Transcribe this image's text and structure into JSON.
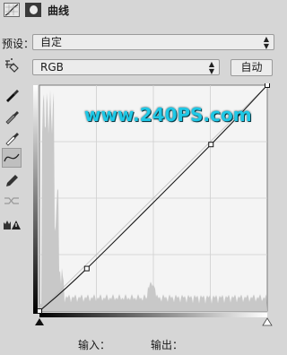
{
  "header": {
    "title": "曲线",
    "icons": [
      "curves-adjustment-icon",
      "layer-mask-icon"
    ]
  },
  "preset": {
    "label": "预设：",
    "value": "自定"
  },
  "channel": {
    "value": "RGB",
    "auto_button": "自动"
  },
  "tools": [
    "on-image-adjust-icon",
    "black-point-eyedropper-icon",
    "gray-point-eyedropper-icon",
    "white-point-eyedropper-icon",
    "curve-edit-icon",
    "pencil-draw-icon",
    "smooth-curve-icon",
    "clipping-warning-icon"
  ],
  "watermark": "www.240PS.com",
  "io": {
    "input_label": "输入：",
    "output_label": "输出："
  },
  "colors": {
    "panel_bg": "#d6d6d6",
    "graph_bg": "#f4f4f4",
    "histogram": "#c8c8c8",
    "watermark": "#1ec8e6"
  },
  "chart_data": {
    "type": "line",
    "xlim": [
      0,
      255
    ],
    "ylim": [
      0,
      255
    ],
    "grid": true,
    "curve_points": [
      [
        0,
        0
      ],
      [
        53,
        48
      ],
      [
        192,
        188
      ],
      [
        255,
        255
      ]
    ],
    "baseline": [
      [
        0,
        0
      ],
      [
        255,
        255
      ]
    ]
  }
}
